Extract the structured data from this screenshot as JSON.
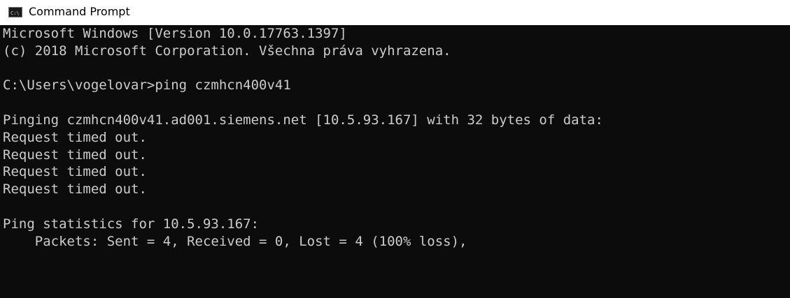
{
  "window": {
    "title": "Command Prompt",
    "icon": "cmd-icon",
    "colors": {
      "background": "#0c0c0c",
      "text": "#cccccc",
      "titlebar": "#ffffff"
    }
  },
  "console": {
    "lines": [
      "Microsoft Windows [Version 10.0.17763.1397]",
      "(c) 2018 Microsoft Corporation. Všechna práva vyhrazena.",
      "",
      "C:\\Users\\vogelovar>ping czmhcn400v41",
      "",
      "Pinging czmhcn400v41.ad001.siemens.net [10.5.93.167] with 32 bytes of data:",
      "Request timed out.",
      "Request timed out.",
      "Request timed out.",
      "Request timed out.",
      "",
      "Ping statistics for 10.5.93.167:",
      "    Packets: Sent = 4, Received = 0, Lost = 4 (100% loss),"
    ]
  }
}
